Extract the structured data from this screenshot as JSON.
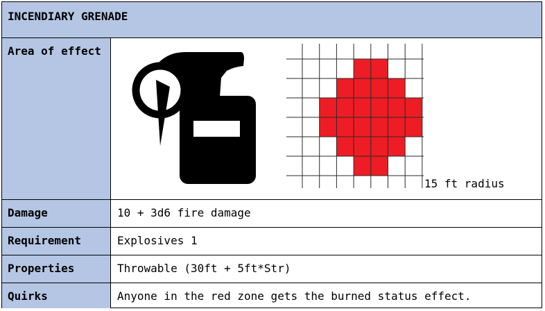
{
  "title": "INCENDIARY GRENADE",
  "rows": {
    "area": {
      "label": "Area of effect",
      "radius_text": "15 ft radius"
    },
    "damage": {
      "label": "Damage",
      "value": "10 + 3d6 fire damage"
    },
    "requirement": {
      "label": "Requirement",
      "value": "Explosives 1"
    },
    "properties": {
      "label": "Properties",
      "value": "Throwable (30ft + 5ft*Str)"
    },
    "quirks": {
      "label": "Quirks",
      "value": "Anyone in the red zone gets the burned status effect."
    }
  },
  "icons": {
    "grenade": "grenade-icon"
  },
  "colors": {
    "header_bg": "#b4c6e4",
    "zone_red": "#ee1c24"
  },
  "area_grid": {
    "cols": 7,
    "rows": 7,
    "filled_cells": [
      [
        0,
        3
      ],
      [
        0,
        4
      ],
      [
        1,
        2
      ],
      [
        1,
        3
      ],
      [
        1,
        4
      ],
      [
        1,
        5
      ],
      [
        2,
        1
      ],
      [
        2,
        2
      ],
      [
        2,
        3
      ],
      [
        2,
        4
      ],
      [
        2,
        5
      ],
      [
        2,
        6
      ],
      [
        3,
        1
      ],
      [
        3,
        2
      ],
      [
        3,
        3
      ],
      [
        3,
        4
      ],
      [
        3,
        5
      ],
      [
        3,
        6
      ],
      [
        4,
        2
      ],
      [
        4,
        3
      ],
      [
        4,
        4
      ],
      [
        4,
        5
      ],
      [
        5,
        3
      ],
      [
        5,
        4
      ]
    ]
  }
}
